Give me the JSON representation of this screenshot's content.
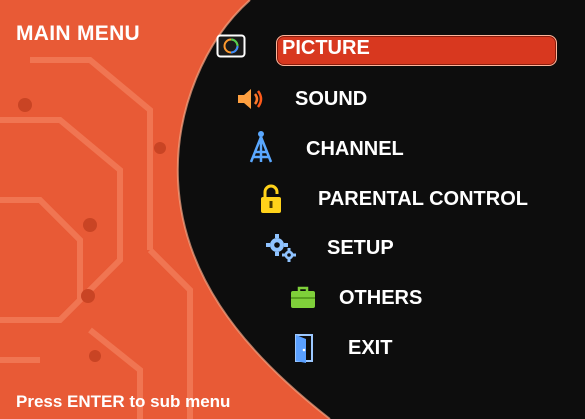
{
  "title": "MAIN MENU",
  "footer_hint": "Press ENTER to sub menu",
  "colors": {
    "background_orange": "#e85a36",
    "menu_panel": "#0d0d0d",
    "highlight": "#d8381f",
    "text": "#ffffff"
  },
  "menu": {
    "selected": "PICTURE",
    "items": [
      {
        "label": "PICTURE",
        "icon": "picture-icon"
      },
      {
        "label": "SOUND",
        "icon": "speaker-icon"
      },
      {
        "label": "CHANNEL",
        "icon": "antenna-icon"
      },
      {
        "label": "PARENTAL CONTROL",
        "icon": "lock-icon"
      },
      {
        "label": "SETUP",
        "icon": "gears-icon"
      },
      {
        "label": "OTHERS",
        "icon": "briefcase-icon"
      },
      {
        "label": "EXIT",
        "icon": "exit-door-icon"
      }
    ]
  }
}
